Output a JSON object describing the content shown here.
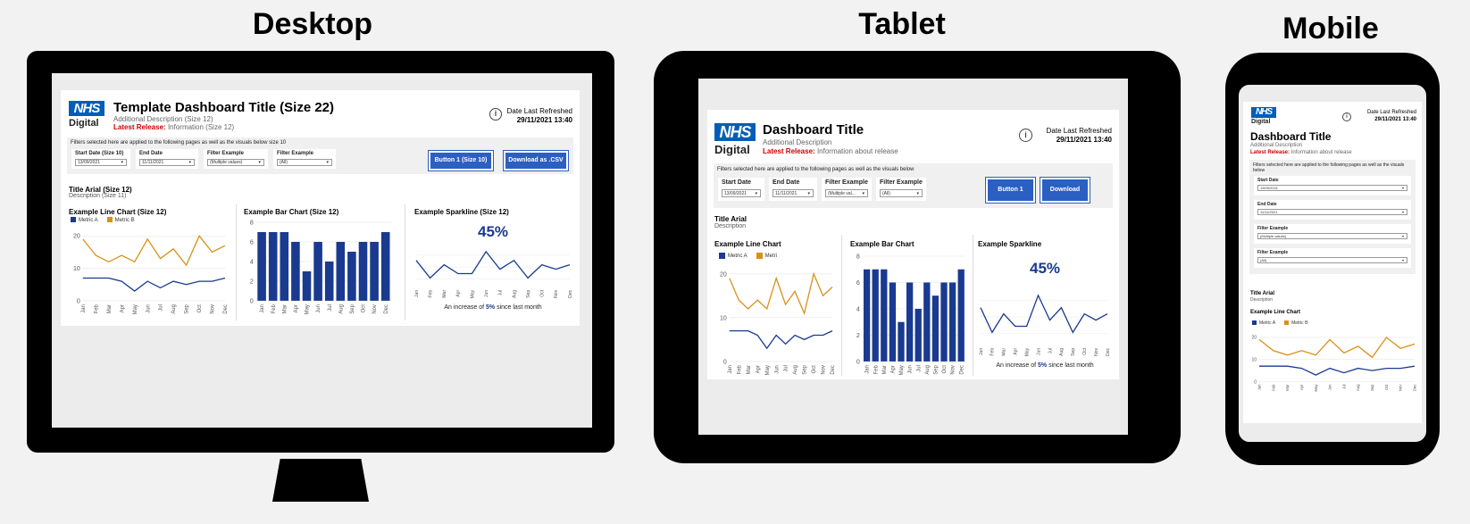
{
  "devices": {
    "desktop": {
      "label": "Desktop",
      "logo": {
        "nhs": "NHS",
        "sub": "Digital"
      },
      "title": "Template Dashboard Title (Size 22)",
      "description": "Additional Description (Size 12)",
      "release_label": "Latest Release:",
      "release_text": "Information (Size 12)",
      "refresh_label": "Date Last Refreshed",
      "refresh_value": "29/11/2021 13:40",
      "filter_note": "Filters selected here are applied to the following pages as well as the visuals below size 10",
      "filters": [
        {
          "label": "Start Date (Size 10)",
          "value": "13/09/2021"
        },
        {
          "label": "End Date",
          "value": "11/11/2021"
        },
        {
          "label": "Filter Example",
          "value": "(Multiple values)"
        },
        {
          "label": "Filter Example",
          "value": "(All)"
        }
      ],
      "button1": "Button 1 (Size 10)",
      "button2": "Download as .CSV",
      "section_title": "Title Arial (Size 12)",
      "section_desc": "Description (Size 11)",
      "line_title": "Example Line Chart (Size 12)",
      "bar_title": "Example Bar Chart (Size 12)",
      "spark_title": "Example Sparkline (Size 12)",
      "legend_a": "Metric A",
      "legend_b": "Metric B",
      "pct": "45%",
      "inc_pre": "An increase of",
      "inc_val": "5%",
      "inc_post": "since last month"
    },
    "tablet": {
      "label": "Tablet",
      "logo": {
        "nhs": "NHS",
        "sub": "Digital"
      },
      "title": "Dashboard Title",
      "description": "Additional Description",
      "release_label": "Latest Release:",
      "release_text": "Information about release",
      "refresh_label": "Date Last Refreshed",
      "refresh_value": "29/11/2021 13:40",
      "filter_note": "Filters selected here are applied to the following pages as well as the visuals below",
      "filters": [
        {
          "label": "Start Date",
          "value": "13/09/2021"
        },
        {
          "label": "End Date",
          "value": "11/11/2021"
        },
        {
          "label": "Filter Example",
          "value": "(Multiple val..."
        },
        {
          "label": "Filter Example",
          "value": "(All)"
        }
      ],
      "button1": "Button 1",
      "button2": "Download",
      "section_title": "Title Arial",
      "section_desc": "Description",
      "line_title": "Example Line Chart",
      "bar_title": "Example Bar Chart",
      "spark_title": "Example Sparkline",
      "legend_a": "Metric A",
      "legend_b": "Metri",
      "pct": "45%",
      "inc_pre": "An increase of",
      "inc_val": "5%",
      "inc_post": "since last month"
    },
    "mobile": {
      "label": "Mobile",
      "logo": {
        "nhs": "NHS",
        "sub": "Digital"
      },
      "title": "Dashboard Title",
      "description": "Additional Description",
      "release_label": "Latest Release:",
      "release_text": "Information about release",
      "refresh_label": "Date Last Refreshed",
      "refresh_value": "29/11/2021 13:40",
      "filter_note": "Filters selected here are applied to the following pages as well as the visuals below",
      "filters": [
        {
          "label": "Start Date",
          "value": "13/09/2021"
        },
        {
          "label": "End Date",
          "value": "11/11/2021"
        },
        {
          "label": "Filter Example",
          "value": "(Multiple values)"
        },
        {
          "label": "Filter Example",
          "value": "(All)"
        }
      ],
      "section_title": "Title Arial",
      "section_desc": "Description",
      "line_title": "Example Line Chart",
      "legend_a": "Metric A",
      "legend_b": "Metric B"
    }
  },
  "colors": {
    "metric_a": "#1a3a8f",
    "metric_b": "#d9901a",
    "bar": "#1a3a8f",
    "nhs_blue": "#005eb8",
    "button": "#2c5fc2"
  },
  "icons": {
    "info": "info-icon",
    "dropdown": "chevron-down-icon"
  },
  "chart_data": [
    {
      "type": "line",
      "title": "Example Line Chart",
      "categories": [
        "Jan",
        "Feb",
        "Mar",
        "Apr",
        "May",
        "Jun",
        "Jul",
        "Aug",
        "Sep",
        "Oct",
        "Nov",
        "Dec"
      ],
      "series": [
        {
          "name": "Metric A",
          "values": [
            7,
            7,
            7,
            6,
            3,
            6,
            4,
            6,
            5,
            6,
            6,
            7
          ]
        },
        {
          "name": "Metric B",
          "values": [
            19,
            14,
            12,
            14,
            12,
            19,
            13,
            16,
            11,
            20,
            15,
            17
          ]
        }
      ],
      "ylim": [
        0,
        22
      ],
      "yticks": [
        0,
        10,
        20
      ]
    },
    {
      "type": "bar",
      "title": "Example Bar Chart",
      "categories": [
        "Jan",
        "Feb",
        "Mar",
        "Apr",
        "May",
        "Jun",
        "Jul",
        "Aug",
        "Sep",
        "Oct",
        "Nov",
        "Dec"
      ],
      "values": [
        7,
        7,
        7,
        6,
        3,
        6,
        4,
        6,
        5,
        6,
        6,
        7
      ],
      "ylim": [
        0,
        8
      ],
      "yticks": [
        0,
        2,
        4,
        6,
        8
      ]
    },
    {
      "type": "line",
      "title": "Example Sparkline",
      "categories": [
        "Jan",
        "Feb",
        "Mar",
        "Apr",
        "May",
        "Jun",
        "Jul",
        "Aug",
        "Sep",
        "Oct",
        "Nov",
        "Dec"
      ],
      "values": [
        7,
        3,
        6,
        4,
        4,
        9,
        5,
        7,
        3,
        6,
        5,
        6
      ],
      "ylim": [
        1,
        10
      ]
    }
  ]
}
